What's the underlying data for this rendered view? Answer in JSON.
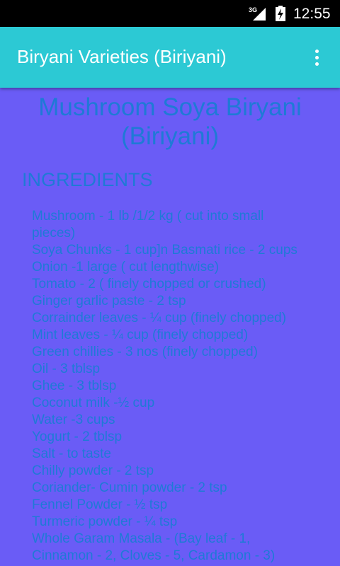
{
  "status_bar": {
    "network": "3G",
    "time": "12:55"
  },
  "app_bar": {
    "title": "Biryani Varieties (Biriyani)",
    "overflow_icon": "more-vert-icon"
  },
  "recipe": {
    "title_line1": "Mushroom Soya Biryani",
    "title_line2": "(Biriyani)",
    "section_heading": "INGREDIENTS",
    "ingredient_lines": [
      "Mushroom - 1 lb /1/2 kg ( cut into small",
      "pieces)",
      " Soya Chunks - 1 cup]n Basmati rice - 2 cups",
      " Onion -1 large ( cut lengthwise)",
      " Tomato - 2 ( finely chopped or crushed)",
      " Ginger garlic paste - 2  tsp",
      " Corrainder leaves - ¼ cup (finely chopped)",
      " Mint leaves - ¼ cup (finely chopped)",
      " Green chillies - 3 nos (finely chopped)",
      " Oil - 3 tblsp",
      " Ghee - 3 tblsp",
      " Coconut milk -½ cup",
      " Water -3 cups",
      " Yogurt - 2 tblsp",
      " Salt - to taste",
      " Chilly powder - 2 tsp",
      " Coriander- Cumin powder - 2 tsp",
      " Fennel Powder - ½ tsp",
      " Turmeric powder - ¼ tsp",
      " Whole Garam Masala - (Bay leaf - 1,",
      "Cinnamon - 2, Cloves - 5, Cardamon - 3)"
    ]
  }
}
